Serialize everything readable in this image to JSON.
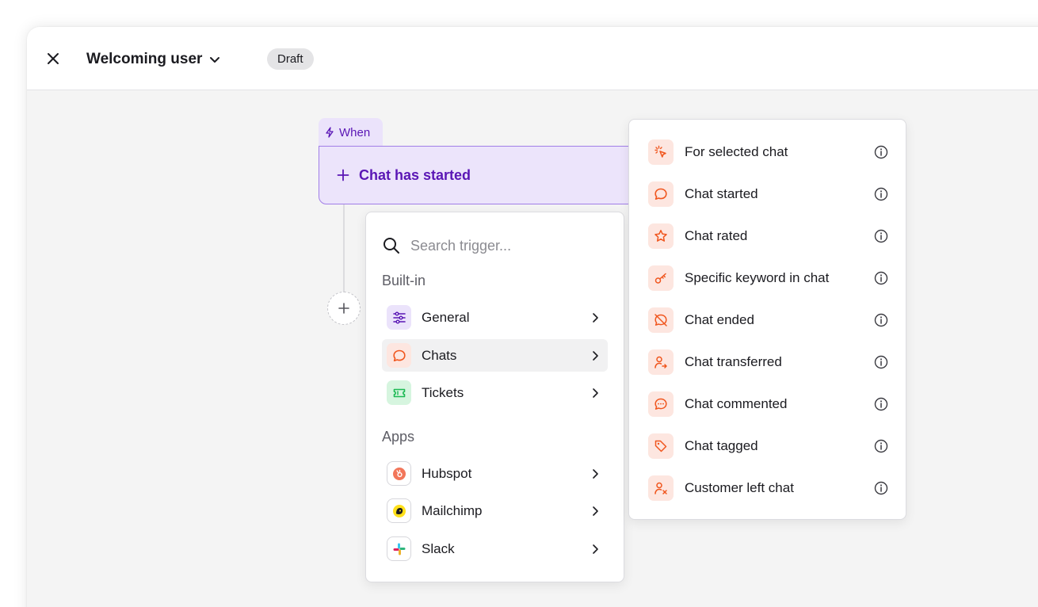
{
  "header": {
    "title": "Welcoming user",
    "status_badge": "Draft"
  },
  "canvas": {
    "when_label": "When",
    "trigger_label": "Chat has started"
  },
  "trigger_menu": {
    "search_placeholder": "Search trigger...",
    "sections": [
      {
        "label": "Built-in",
        "items": [
          {
            "label": "General",
            "icon": "sliders-icon"
          },
          {
            "label": "Chats",
            "icon": "chat-bubble-icon",
            "active": true
          },
          {
            "label": "Tickets",
            "icon": "ticket-icon"
          }
        ]
      },
      {
        "label": "Apps",
        "items": [
          {
            "label": "Hubspot",
            "icon": "hubspot-icon"
          },
          {
            "label": "Mailchimp",
            "icon": "mailchimp-icon"
          },
          {
            "label": "Slack",
            "icon": "slack-icon"
          }
        ]
      }
    ]
  },
  "chat_triggers": [
    {
      "label": "For selected chat",
      "icon": "cursor-click-icon"
    },
    {
      "label": "Chat started",
      "icon": "chat-bubble-icon"
    },
    {
      "label": "Chat rated",
      "icon": "star-icon"
    },
    {
      "label": "Specific keyword in chat",
      "icon": "key-icon"
    },
    {
      "label": "Chat ended",
      "icon": "chat-off-icon"
    },
    {
      "label": "Chat transferred",
      "icon": "user-transfer-icon"
    },
    {
      "label": "Chat commented",
      "icon": "chat-comment-icon"
    },
    {
      "label": "Chat tagged",
      "icon": "tag-icon"
    },
    {
      "label": "Customer left chat",
      "icon": "user-remove-icon"
    }
  ],
  "colors": {
    "accent_purple": "#5a16b5",
    "trigger_bg": "#ece4fb",
    "chat_orange": "#f0561e",
    "ticket_green": "#1db954"
  }
}
